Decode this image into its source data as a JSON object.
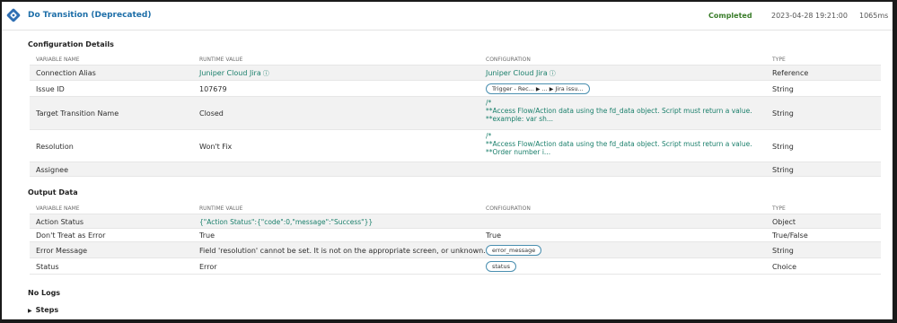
{
  "header": {
    "title": "Do Transition (Deprecated)",
    "status": "Completed",
    "timestamp": "2023-04-28 19:21:00",
    "duration": "1065ms",
    "status_color": "#3a7d2a",
    "icon": "diamond-step-icon"
  },
  "columns": {
    "variable_name": "VARIABLE NAME",
    "runtime_value": "RUNTIME VALUE",
    "configuration": "CONFIGURATION",
    "type": "TYPE"
  },
  "config_details": {
    "title": "Configuration Details",
    "rows": [
      {
        "name": "Connection Alias",
        "runtime": "Juniper Cloud Jira",
        "config": "Juniper Cloud Jira",
        "type": "Reference"
      },
      {
        "name": "Issue ID",
        "runtime": "107679",
        "config_pill": {
          "part1": "Trigger - Rec...",
          "part2": "...",
          "part3": "Jira issu..."
        },
        "type": "String"
      },
      {
        "name": "Target Transition Name",
        "runtime": "Closed",
        "config_lines": [
          "/*",
          "**Access Flow/Action data using the fd_data object. Script must return a value.",
          "**example: var sh..."
        ],
        "type": "String"
      },
      {
        "name": "Resolution",
        "runtime": "Won't Fix",
        "config_lines": [
          "/*",
          "**Access Flow/Action data using the fd_data object. Script must return a value.",
          "**Order number i..."
        ],
        "type": "String"
      },
      {
        "name": "Assignee",
        "runtime": "",
        "type": "String"
      }
    ]
  },
  "output_data": {
    "title": "Output Data",
    "rows": [
      {
        "name": "Action Status",
        "runtime": "{\"Action Status\":{\"code\":0,\"message\":\"Success\"}}",
        "config": "",
        "type": "Object"
      },
      {
        "name": "Don't Treat as Error",
        "runtime": "True",
        "config": "True",
        "type": "True/False"
      },
      {
        "name": "Error Message",
        "runtime": "Field 'resolution' cannot be set. It is not on the appropriate screen, or unknown.",
        "config_pill": "error_message",
        "type": "String"
      },
      {
        "name": "Status",
        "runtime": "Error",
        "config_pill": "status",
        "type": "Choice"
      }
    ]
  },
  "logs": {
    "label": "No Logs"
  },
  "steps": {
    "label": "Steps"
  }
}
